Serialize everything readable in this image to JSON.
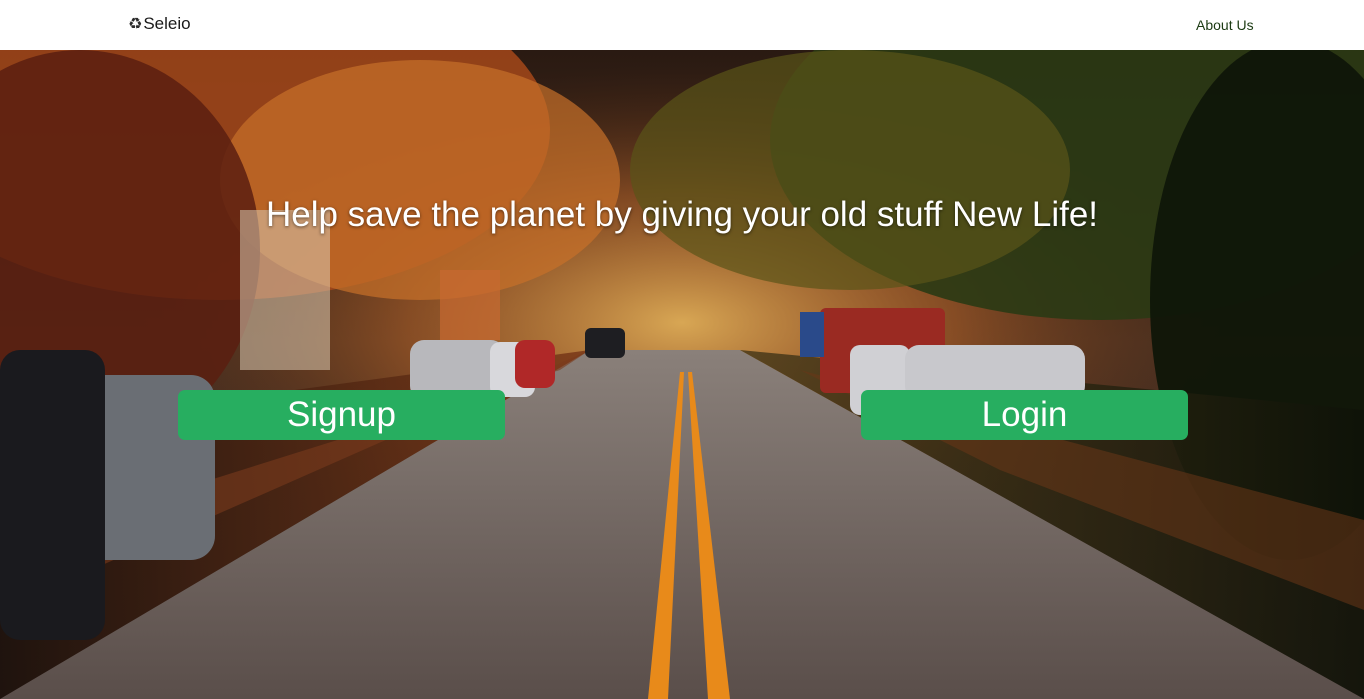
{
  "navbar": {
    "brand_icon": "♻",
    "brand_name": "Seleio",
    "about_link": "About Us"
  },
  "hero": {
    "headline": "Help save the planet by giving your old stuff New Life!",
    "signup_label": "Signup",
    "login_label": "Login",
    "background": "autumn-tree-lined-street-photo"
  },
  "colors": {
    "button": "#27ae60",
    "navbar_bg": "#ffffff",
    "headline_text": "#ffffff"
  }
}
